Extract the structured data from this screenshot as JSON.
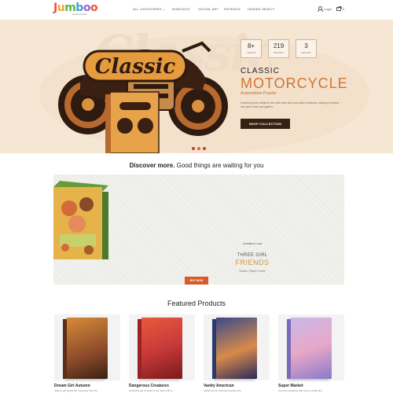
{
  "header": {
    "logo_letters": [
      "J",
      "u",
      "m",
      "b",
      "o",
      "o"
    ],
    "logo_sub": "growing better",
    "nav": [
      "ALL CATEGORIES",
      "ROBOZZLE",
      "DIGITAL ART",
      "PATIENCE",
      "HIDDEN OBJECT"
    ],
    "login": "Login",
    "cart_count": "0"
  },
  "hero": {
    "bg_text": "Classic",
    "badges": [
      {
        "num": "8+",
        "label": "YEARS"
      },
      {
        "num": "219",
        "label": "PIECES"
      },
      {
        "num": "3",
        "label": "HOURS"
      }
    ],
    "title_line1": "CLASSIC",
    "title_line2": "MOTORCYCLE",
    "subtitle": "Automotive Puzzle",
    "description": "A perfect puzzle crafted for the bold riders and road-culture dreamers, making it a perfect next piece when put together.",
    "button": "SHOP COLLECTION",
    "colors": {
      "accent": "#d17435",
      "button": "#3a2012",
      "background": "#f6e6d4"
    }
  },
  "discover": {
    "bold": "Discover more.",
    "rest": "Good things are waiting for you"
  },
  "promo": {
    "small_label": "SUITABLE 8 + AGE",
    "title1": "THREE GIRL",
    "title2": "FRIENDS",
    "subtitle": "Hidden Object Puzzle",
    "button": "BUY NOW"
  },
  "featured": {
    "title": "Featured Products",
    "products": [
      {
        "name": "Dream Girl Autumn",
        "desc": "Autumn girl brings the memories from the"
      },
      {
        "name": "Dangerous Creatures",
        "desc": "Creatures get involved in the future with a"
      },
      {
        "name": "Vanity American",
        "desc": "Stylish pin-up unknown freedom the"
      },
      {
        "name": "Super Market",
        "desc": "Get busy shopping with a busy market the"
      }
    ]
  }
}
